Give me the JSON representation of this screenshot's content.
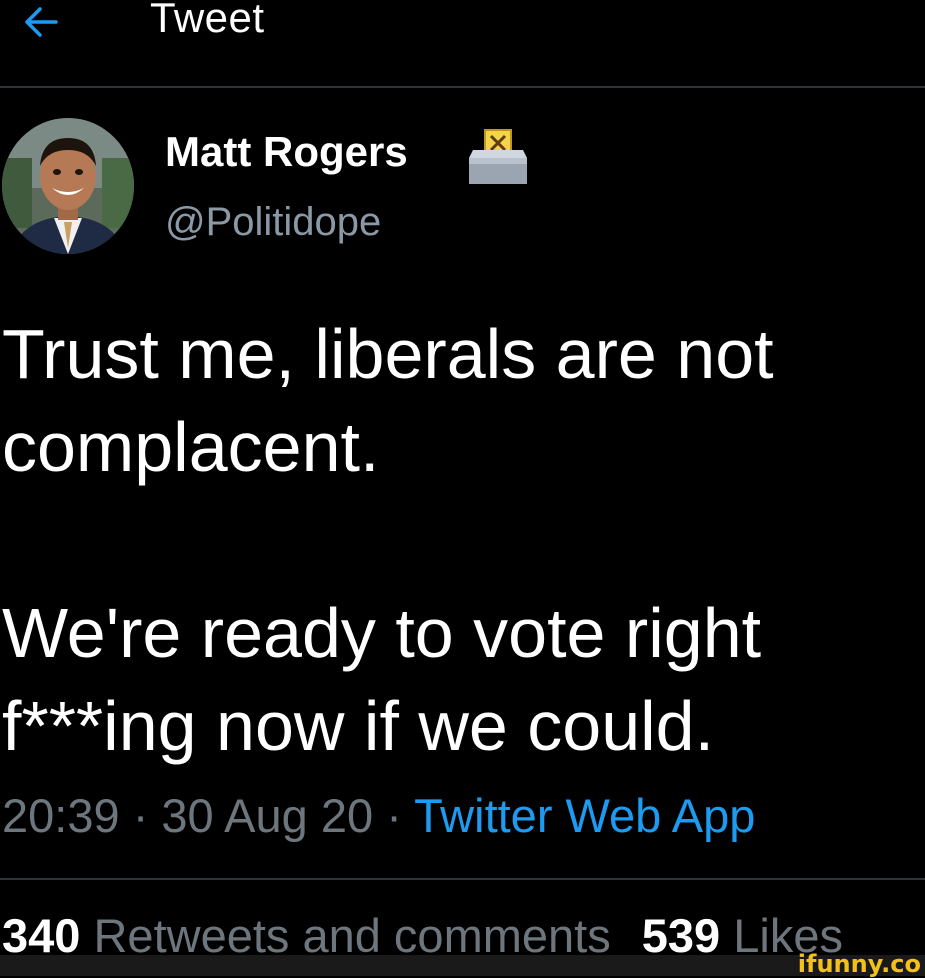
{
  "header": {
    "back_icon": "arrow-left-icon",
    "title": "Tweet"
  },
  "author": {
    "display_name": "Matt Rogers",
    "badge_icon": "ballot-box-icon",
    "handle": "@Politidope"
  },
  "tweet": {
    "paragraphs": [
      "Trust me, liberals are not",
      "complacent.",
      "",
      "We're ready to vote right",
      "f***ing now if we could."
    ],
    "time": "20:39",
    "date": "30 Aug 20",
    "separator": "·",
    "source": "Twitter Web App"
  },
  "stats": {
    "retweets_count": "340",
    "retweets_label": "Retweets and comments",
    "likes_count": "539",
    "likes_label": "Likes"
  },
  "watermark": "ifunny.co",
  "colors": {
    "background": "#000000",
    "text_primary": "#ffffff",
    "text_secondary": "#6e767d",
    "accent": "#1d9bf0",
    "divider": "#2f3336",
    "watermark": "#f2c01a"
  }
}
